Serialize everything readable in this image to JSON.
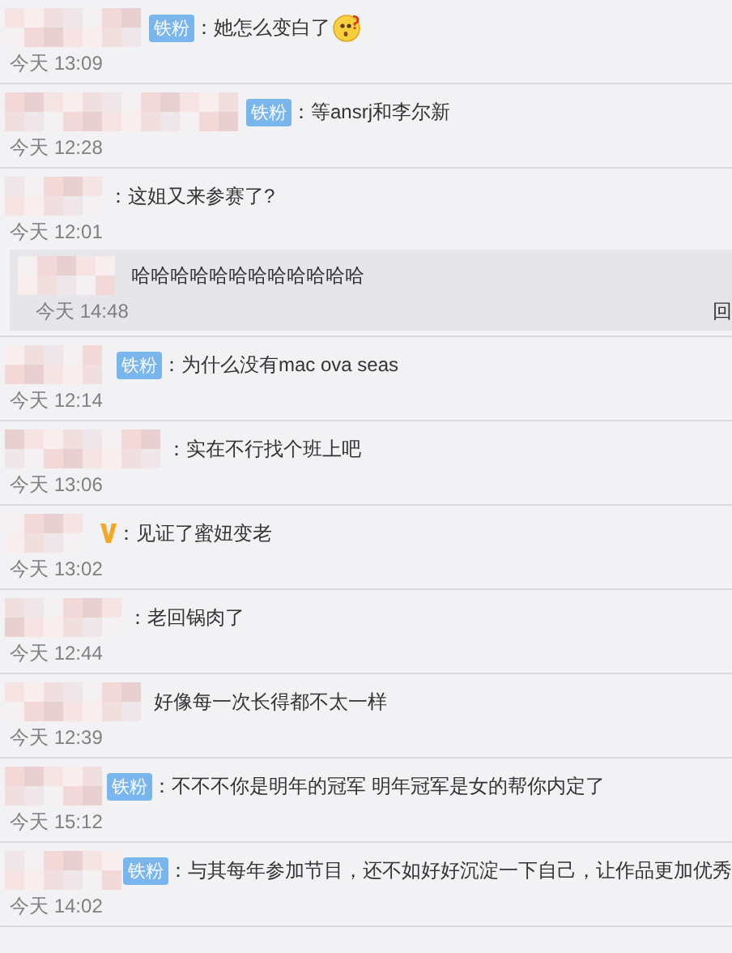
{
  "comments": [
    {
      "badge": {
        "kind": "fan",
        "text": "铁粉"
      },
      "text": "：她怎么变白了",
      "emoji": true,
      "time": "今天 13:09"
    },
    {
      "badge": {
        "kind": "fan",
        "text": "铁粉"
      },
      "text": "：等ansrj和李尔新",
      "time": "今天 12:28"
    },
    {
      "text": "：这姐又来参赛了?",
      "time": "今天 12:01",
      "replies": [
        {
          "text": "哈哈哈哈哈哈哈哈哈哈哈哈",
          "time": "今天 14:48",
          "action": "回"
        }
      ]
    },
    {
      "badge": {
        "kind": "fan",
        "text": "铁粉"
      },
      "text": "：为什么没有mac ova seas",
      "time": "今天 12:14"
    },
    {
      "text": "：实在不行找个班上吧",
      "time": "今天 13:06"
    },
    {
      "badge": {
        "kind": "verified"
      },
      "text": "：见证了蜜妞变老",
      "time": "今天 13:02"
    },
    {
      "text": "：老回锅肉了",
      "time": "今天 12:44"
    },
    {
      "text": "好像每一次长得都不太一样",
      "time": "今天 12:39"
    },
    {
      "badge": {
        "kind": "fan",
        "text": "铁粉"
      },
      "text": "：不不不你是明年的冠军  明年冠军是女的帮你内定了",
      "time": "今天 15:12"
    },
    {
      "badge": {
        "kind": "fan",
        "text": "铁粉"
      },
      "text": "：与其每年参加节目，还不如好好沉淀一下自己，让作品更加优秀",
      "time": "今天 14:02"
    }
  ]
}
